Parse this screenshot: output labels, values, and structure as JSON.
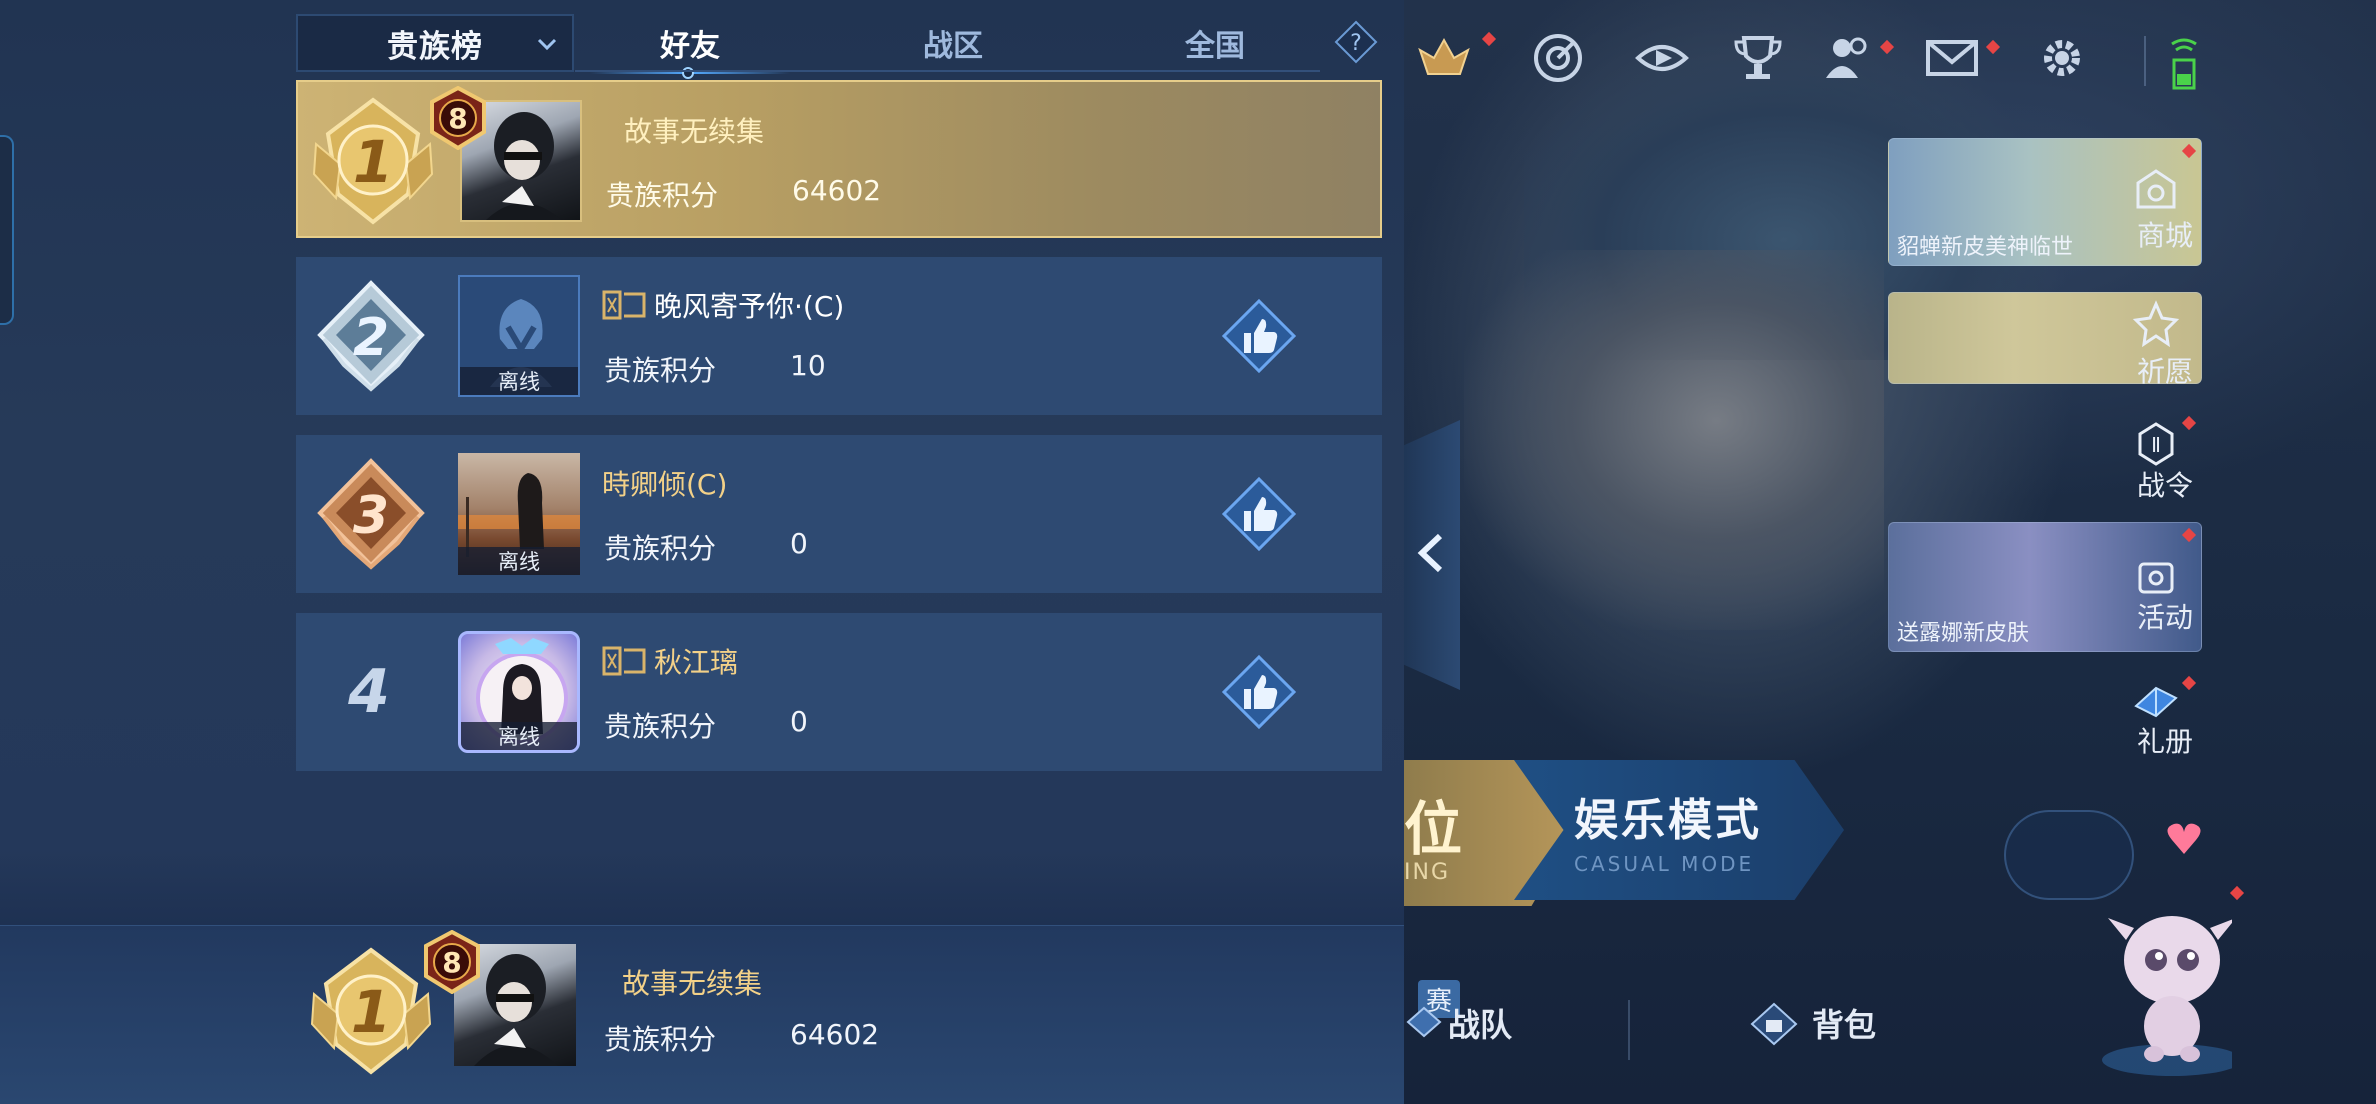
{
  "leaderboard": {
    "dropdown_label": "贵族榜",
    "tabs": [
      {
        "label": "好友"
      },
      {
        "label": "战区"
      },
      {
        "label": "全国"
      }
    ],
    "help_icon": "question-icon",
    "rows": [
      {
        "rank": "1",
        "name": "故事无续集",
        "score_label": "贵族积分",
        "score": "64602",
        "vip_level": "8",
        "status": ""
      },
      {
        "rank": "2",
        "name": "晚风寄予你·(C)",
        "score_label": "贵族积分",
        "score": "10",
        "status": "离线"
      },
      {
        "rank": "3",
        "name": "時卿倾(C)",
        "score_label": "贵族积分",
        "score": "0",
        "status": "离线"
      },
      {
        "rank": "4",
        "name": "秋江璃",
        "score_label": "贵族积分",
        "score": "0",
        "status": "离线"
      }
    ],
    "self": {
      "rank": "1",
      "name": "故事无续集",
      "score_label": "贵族积分",
      "score": "64602",
      "vip_level": "8"
    }
  },
  "right_menu": {
    "cards": [
      {
        "caption": "貂蝉新皮美神临世",
        "label": "商城"
      },
      {
        "caption": "",
        "label": "祈愿"
      },
      {
        "caption": "送露娜新皮肤",
        "label": "活动"
      }
    ],
    "side_labels": {
      "battle_pass": "战令",
      "gift_book": "礼册"
    },
    "modes": {
      "rank_big": "位",
      "rank_sub": "ING",
      "casual_big": "娱乐模式",
      "casual_sub": "CASUAL MODE"
    },
    "bottom_nav": {
      "season_tag": "赛",
      "team": "战队",
      "bag": "背包"
    }
  },
  "colors": {
    "gold_row": "#c3aa6c",
    "row_bg": "#2e4a72",
    "accent_blue": "#54aaff",
    "gold_name": "#f3d188"
  }
}
